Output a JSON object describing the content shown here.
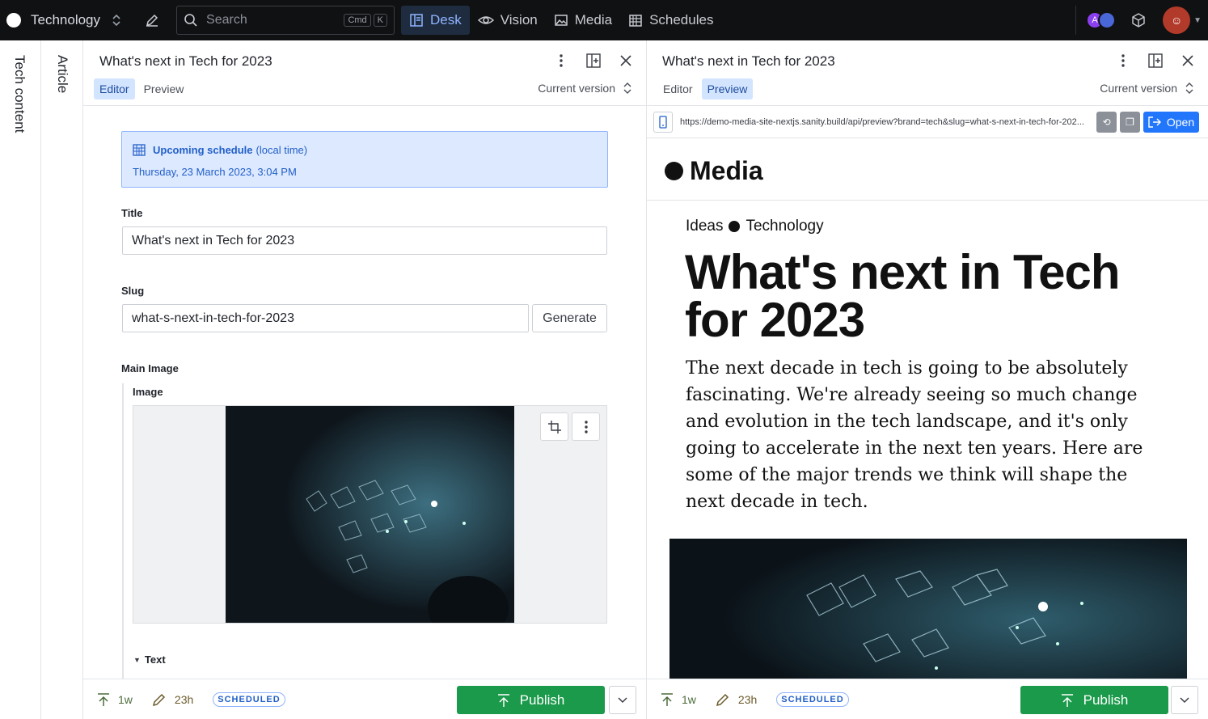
{
  "topbar": {
    "workspace": "Technology",
    "search_placeholder": "Search",
    "search_kbd": [
      "Cmd",
      "K"
    ],
    "nav": [
      {
        "label": "Desk",
        "icon": "desk-icon",
        "active": true
      },
      {
        "label": "Vision",
        "icon": "eye-icon",
        "active": false
      },
      {
        "label": "Media",
        "icon": "image-icon",
        "active": false
      },
      {
        "label": "Schedules",
        "icon": "calendar-icon",
        "active": false
      }
    ],
    "avatar_initial": "A"
  },
  "panes": {
    "tech_content": "Tech content",
    "article": "Article"
  },
  "editor_pane": {
    "title": "What's next in Tech for 2023",
    "tabs": [
      "Editor",
      "Preview"
    ],
    "active_tab": "Editor",
    "version": "Current version",
    "schedule": {
      "label": "Upcoming schedule",
      "sub": "(local time)",
      "date": "Thursday, 23 March 2023, 3:04 PM"
    },
    "fields": {
      "title_label": "Title",
      "title_value": "What's next in Tech for 2023",
      "slug_label": "Slug",
      "slug_value": "what-s-next-in-tech-for-2023",
      "generate_label": "Generate",
      "main_image_label": "Main Image",
      "image_label": "Image",
      "text_label": "Text"
    },
    "footer": {
      "published_ago": "1w",
      "edited_ago": "23h",
      "status": "SCHEDULED",
      "publish_label": "Publish"
    }
  },
  "preview_pane": {
    "title": "What's next in Tech for 2023",
    "tabs": [
      "Editor",
      "Preview"
    ],
    "active_tab": "Preview",
    "version": "Current version",
    "url": "https://demo-media-site-nextjs.sanity.build/api/preview?brand=tech&slug=what-s-next-in-tech-for-202...",
    "open_label": "Open",
    "site": {
      "brand": "Media",
      "crumb1": "Ideas",
      "crumb2": "Technology",
      "headline": "What's next in Tech for 2023",
      "lede": "The next decade in tech is going to be absolutely fascinating. We're already seeing so much change and evolution in the tech landscape, and it's only going to accelerate in the next ten years. Here are some of the major trends we think will shape the next decade in tech."
    },
    "footer": {
      "published_ago": "1w",
      "edited_ago": "23h",
      "status": "SCHEDULED",
      "publish_label": "Publish"
    }
  },
  "colors": {
    "topbar_bg": "#101112",
    "accent": "#2276fc",
    "publish_green": "#1a9a4a",
    "schedule_bg": "#dde9ff"
  }
}
